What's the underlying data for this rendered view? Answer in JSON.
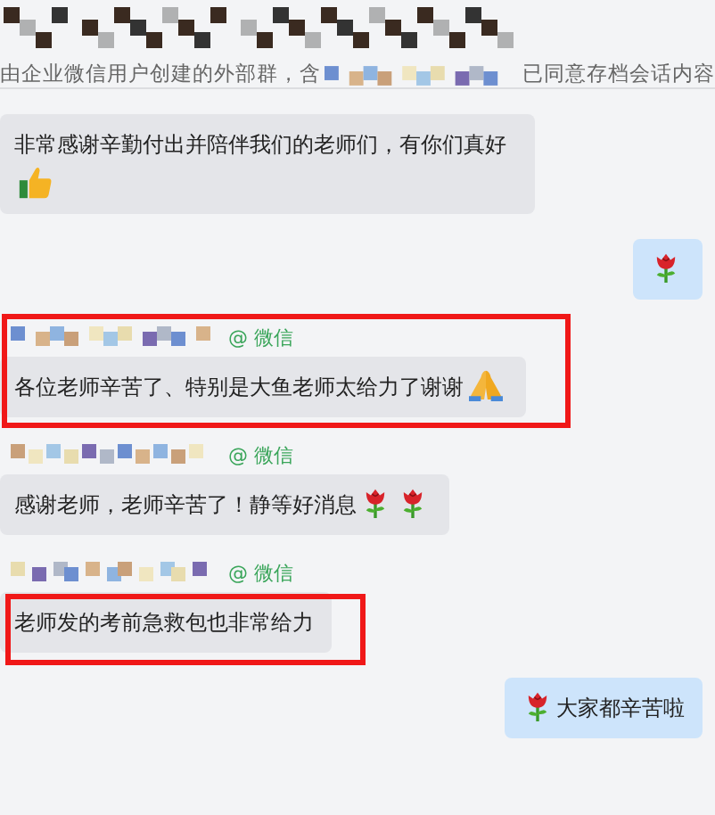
{
  "header": {
    "subtitle_start": "由企业微信用户创建的外部群，含",
    "subtitle_end": "已同意存档会话内容"
  },
  "messages": [
    {
      "kind": "received",
      "highlighted": false,
      "parts": [
        {
          "kind": "text",
          "text": "非常感谢辛勤付出并陪伴我们的老师们，有你们真好"
        },
        {
          "kind": "thumbs"
        }
      ]
    },
    {
      "kind": "sent",
      "highlighted": false,
      "parts": [
        {
          "kind": "rose"
        }
      ]
    },
    {
      "kind": "received",
      "sender": {
        "suffix": "@ 微信"
      },
      "highlighted": true,
      "parts": [
        {
          "kind": "text",
          "text": "各位老师辛苦了、特别是大鱼老师太给力了谢谢"
        },
        {
          "kind": "pray"
        }
      ]
    },
    {
      "kind": "received",
      "sender": {
        "suffix": "@ 微信"
      },
      "highlighted": false,
      "parts": [
        {
          "kind": "text",
          "text": "感谢老师，老师辛苦了！静等好消息"
        },
        {
          "kind": "rose"
        },
        {
          "kind": "rose"
        }
      ]
    },
    {
      "kind": "received",
      "sender": {
        "suffix": "@ 微信"
      },
      "highlighted": true,
      "parts": [
        {
          "kind": "text",
          "text": "老师发的考前急救包也非常给力"
        }
      ]
    },
    {
      "kind": "sent",
      "highlighted": false,
      "parts": [
        {
          "kind": "rose"
        },
        {
          "kind": "text",
          "text": "大家都辛苦啦"
        }
      ]
    }
  ]
}
